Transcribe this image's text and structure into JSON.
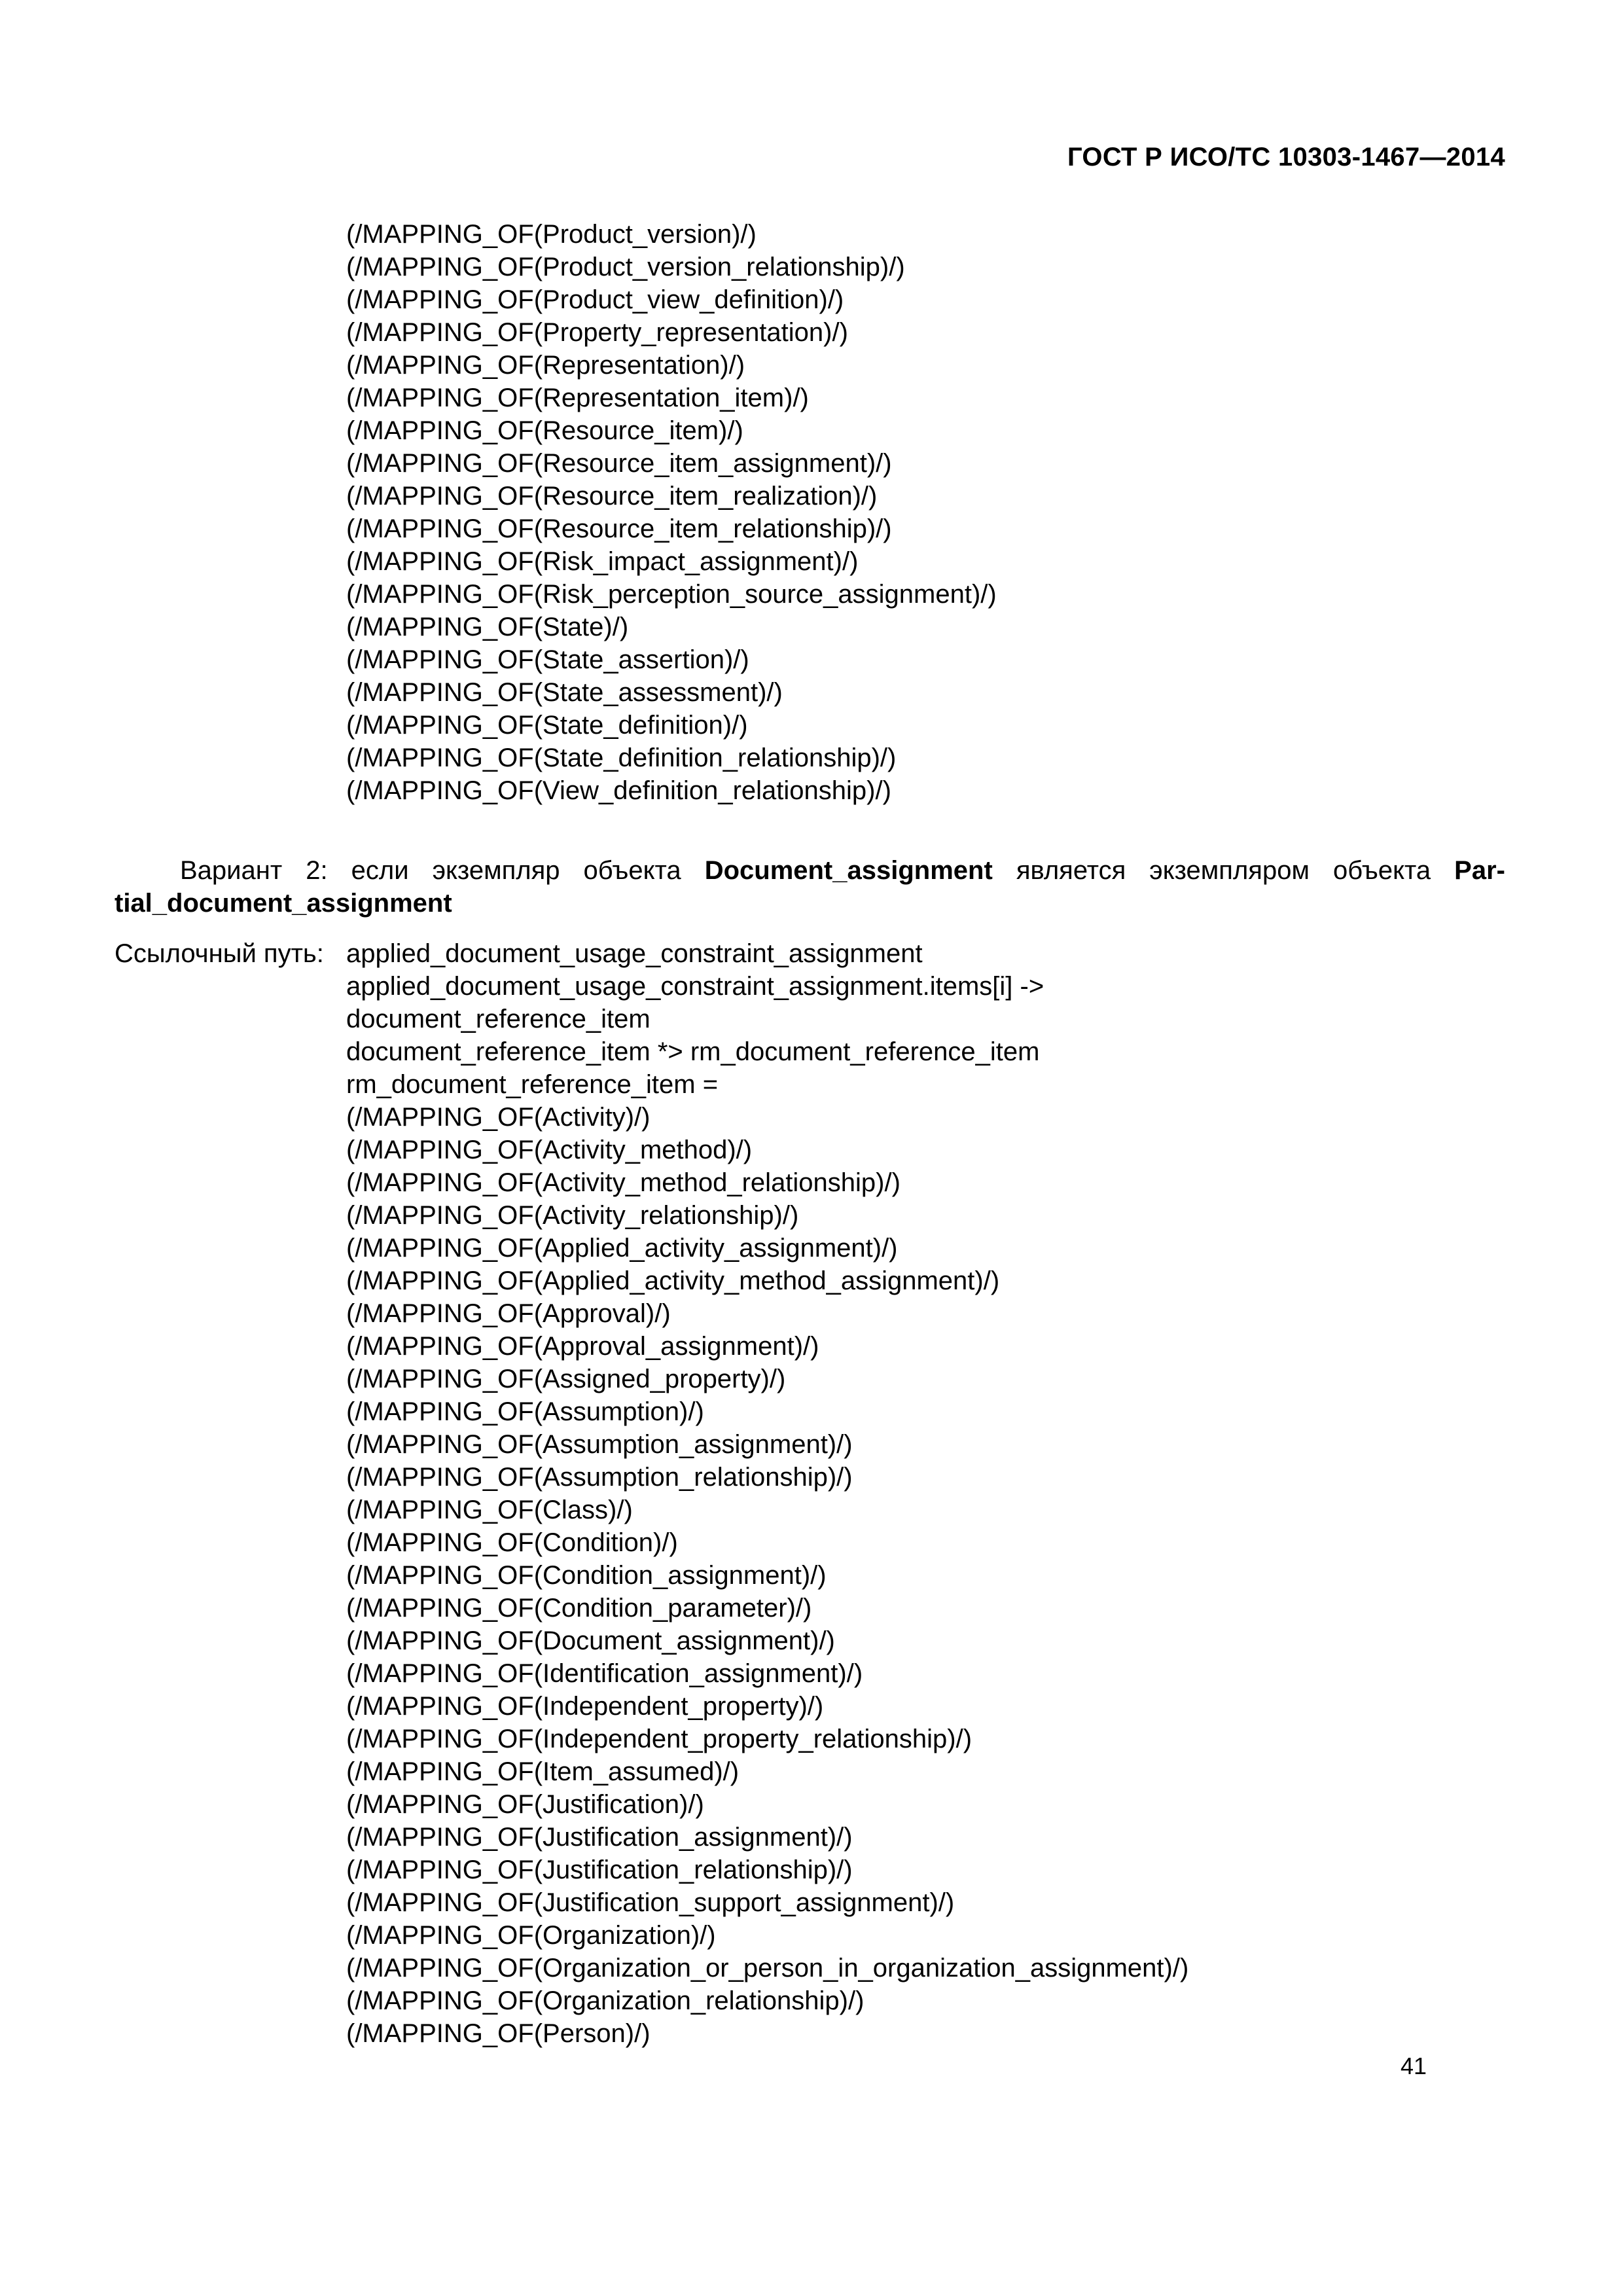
{
  "document": {
    "header": "ГОСТ Р ИСО/ТС 10303-1467—2014",
    "page_number": "41"
  },
  "mapping_block_one": [
    "(/MAPPING_OF(Product_version)/)",
    "(/MAPPING_OF(Product_version_relationship)/)",
    "(/MAPPING_OF(Product_view_definition)/)",
    "(/MAPPING_OF(Property_representation)/)",
    "(/MAPPING_OF(Representation)/)",
    "(/MAPPING_OF(Representation_item)/)",
    "(/MAPPING_OF(Resource_item)/)",
    "(/MAPPING_OF(Resource_item_assignment)/)",
    "(/MAPPING_OF(Resource_item_realization)/)",
    "(/MAPPING_OF(Resource_item_relationship)/)",
    "(/MAPPING_OF(Risk_impact_assignment)/)",
    "(/MAPPING_OF(Risk_perception_source_assignment)/)",
    "(/MAPPING_OF(State)/)",
    "(/MAPPING_OF(State_assertion)/)",
    "(/MAPPING_OF(State_assessment)/)",
    "(/MAPPING_OF(State_definition)/)",
    "(/MAPPING_OF(State_definition_relationship)/)",
    "(/MAPPING_OF(View_definition_relationship)/)"
  ],
  "variant": {
    "prefix": "Вариант 2: если экземпляр объекта ",
    "bold_one": "Document_assignment",
    "middle": " является экземпляром объекта ",
    "bold_two": "Par­tial_document_assignment"
  },
  "reference_path": {
    "label": "Ссылочный путь:",
    "lines": [
      "applied_document_usage_constraint_assignment",
      "applied_document_usage_constraint_assignment.items[i] ->",
      "document_reference_item",
      "document_reference_item *> rm_document_reference_item",
      "rm_document_reference_item =",
      "(/MAPPING_OF(Activity)/)",
      "(/MAPPING_OF(Activity_method)/)",
      "(/MAPPING_OF(Activity_method_relationship)/)",
      "(/MAPPING_OF(Activity_relationship)/)",
      "(/MAPPING_OF(Applied_activity_assignment)/)",
      "(/MAPPING_OF(Applied_activity_method_assignment)/)",
      "(/MAPPING_OF(Approval)/)",
      "(/MAPPING_OF(Approval_assignment)/)",
      "(/MAPPING_OF(Assigned_property)/)",
      "(/MAPPING_OF(Assumption)/)",
      "(/MAPPING_OF(Assumption_assignment)/)",
      "(/MAPPING_OF(Assumption_relationship)/)",
      "(/MAPPING_OF(Class)/)",
      "(/MAPPING_OF(Condition)/)",
      "(/MAPPING_OF(Condition_assignment)/)",
      "(/MAPPING_OF(Condition_parameter)/)",
      "(/MAPPING_OF(Document_assignment)/)",
      "(/MAPPING_OF(Identification_assignment)/)",
      "(/MAPPING_OF(Independent_property)/)",
      "(/MAPPING_OF(Independent_property_relationship)/)",
      "(/MAPPING_OF(Item_assumed)/)",
      "(/MAPPING_OF(Justification)/)",
      "(/MAPPING_OF(Justification_assignment)/)",
      "(/MAPPING_OF(Justification_relationship)/)",
      "(/MAPPING_OF(Justification_support_assignment)/)",
      "(/MAPPING_OF(Organization)/)",
      "(/MAPPING_OF(Organization_or_person_in_organization_assignment)/)",
      "(/MAPPING_OF(Organization_relationship)/)",
      "(/MAPPING_OF(Person)/)"
    ]
  }
}
